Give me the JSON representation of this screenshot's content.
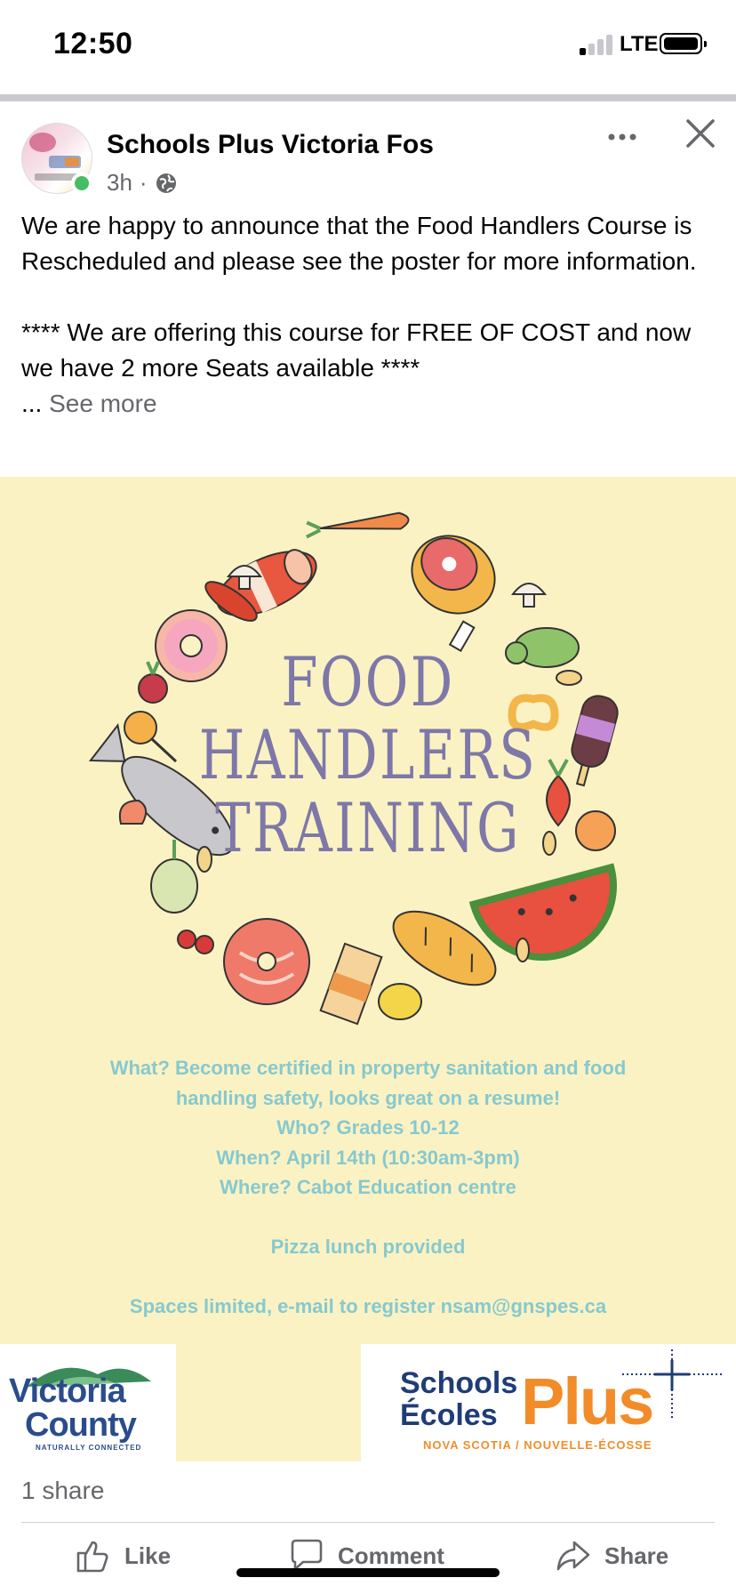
{
  "status_bar": {
    "time": "12:50",
    "network": "LTE"
  },
  "post": {
    "page_name": "Schools Plus Victoria Fos",
    "timestamp": "3h",
    "separator": "·",
    "text_lines": [
      "We are happy to announce that the Food Handlers Course is Rescheduled and please see the poster for more information.",
      "**** We are offering this course for FREE OF COST and now we have 2 more Seats available ****"
    ],
    "ellipsis": "...",
    "see_more": "See more"
  },
  "poster": {
    "headline": [
      "FOOD",
      "HANDLERS",
      "TRAINING"
    ],
    "info": [
      "What? Become certified in property sanitation and food",
      "handling safety, looks great on a resume!",
      "Who? Grades 10-12",
      "When? April 14th  (10:30am-3pm)",
      "Where? Cabot Education centre",
      "Pizza lunch provided",
      "Spaces limited, e-mail to register nsam@gnspes.ca"
    ],
    "colors": {
      "background": "#fbf2c3",
      "headline": "#7d78a8",
      "info": "#86c9cf"
    }
  },
  "logos": {
    "victoria_county": {
      "line1": "Victoria",
      "line2": "County",
      "tagline": "NATURALLY CONNECTED"
    },
    "schools_plus": {
      "schools": "Schools",
      "ecoles": "Écoles",
      "plus": "Plus",
      "tagline": "NOVA SCOTIA / NOUVELLE-ÉCOSSE"
    }
  },
  "engagement": {
    "shares": "1 share"
  },
  "actions": {
    "like": "Like",
    "comment": "Comment",
    "share": "Share"
  },
  "icons": [
    "globe-icon",
    "more-options-icon",
    "close-icon",
    "like-icon",
    "comment-icon",
    "share-icon"
  ]
}
